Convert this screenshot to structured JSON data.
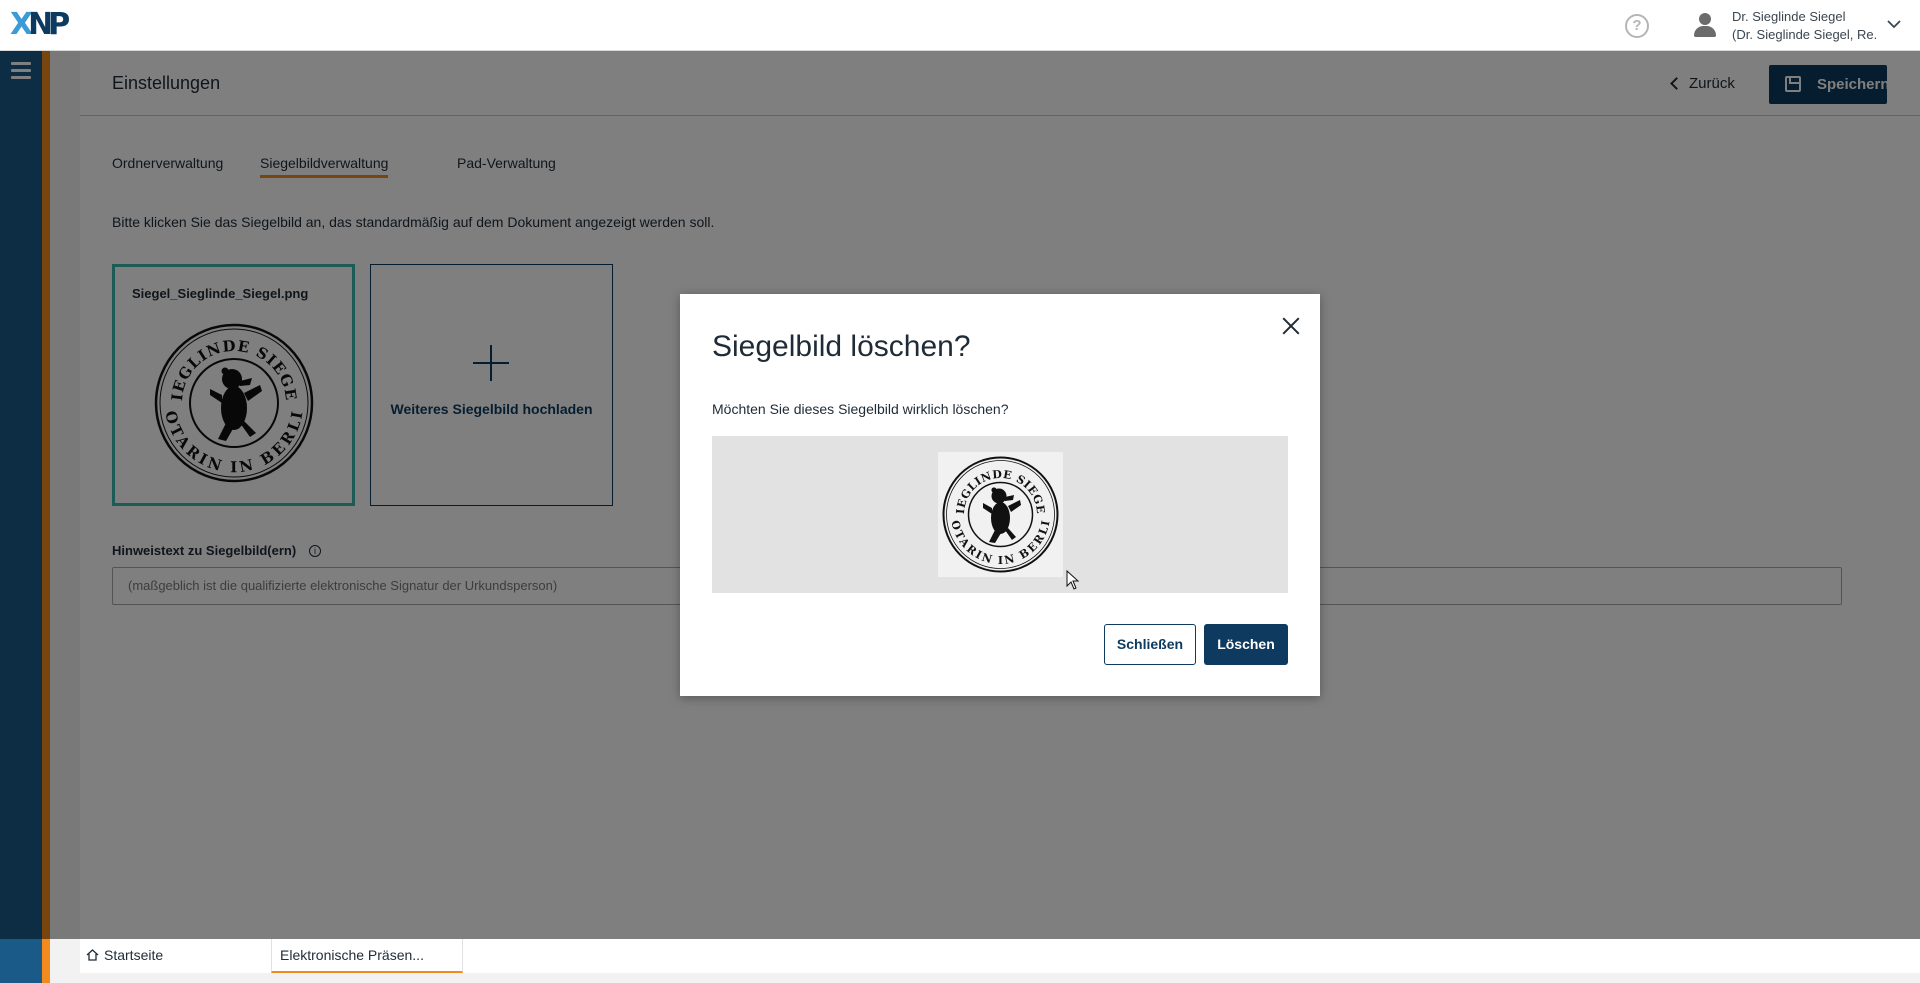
{
  "app": {
    "logo_text": "XNP",
    "colors": {
      "primary": "#0d3a5e",
      "accent": "#f28a1d",
      "selected": "#3ab6ae",
      "sidebar": "#1a5a89"
    }
  },
  "header": {
    "user_name": "Dr. Sieglinde Siegel",
    "user_sub": "(Dr. Sieglinde Siegel, Re...",
    "help_icon": "question-circle-icon"
  },
  "page": {
    "title": "Einstellungen",
    "back_label": "Zurück",
    "save_label": "Speichern"
  },
  "tabs": [
    {
      "label": "Ordnerverwaltung",
      "active": false
    },
    {
      "label": "Siegelbildverwaltung",
      "active": true
    },
    {
      "label": "Pad-Verwaltung",
      "active": false
    }
  ],
  "intro_text": "Bitte klicken Sie das Siegelbild an, das standardmäßig auf dem Dokument angezeigt werden soll.",
  "seal_card": {
    "filename": "Siegel_Sieglinde_Siegel.png",
    "seal_top_text": "SIEGLINDE SIEGEL",
    "seal_bottom_text": "NOTARIN IN BERLIN"
  },
  "upload_card": {
    "label": "Weiteres Siegelbild hochladen"
  },
  "hint": {
    "label": "Hinweistext zu Siegelbild(ern)",
    "placeholder": "(maßgeblich ist die qualifizierte elektronische Signatur der Urkundsperson)"
  },
  "taskbar": {
    "home_label": "Startseite",
    "active_tab_label": "Elektronische Präsen..."
  },
  "modal": {
    "title": "Siegelbild löschen?",
    "text": "Möchten Sie dieses Siegelbild wirklich löschen?",
    "close_label": "Schließen",
    "delete_label": "Löschen"
  }
}
